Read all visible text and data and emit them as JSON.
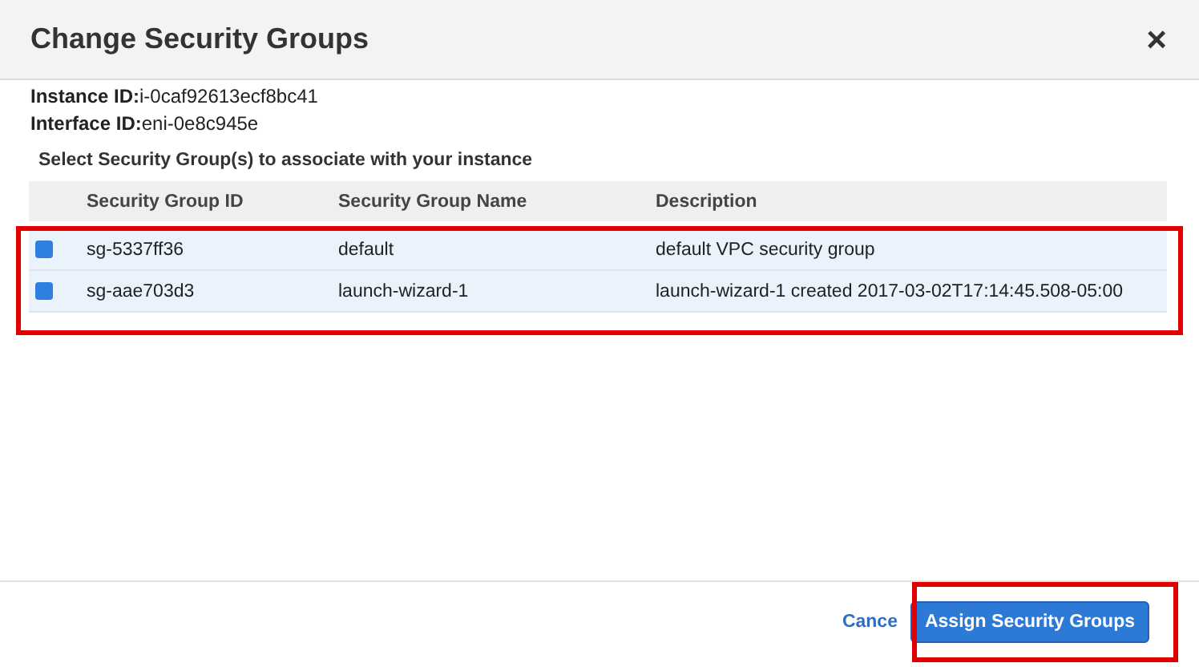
{
  "dialog": {
    "title": "Change Security Groups",
    "close": "×"
  },
  "info": [
    {
      "label": "Instance ID:",
      "value": "i-0caf92613ecf8bc41"
    },
    {
      "label": "Interface ID:",
      "value": "eni-0e8c945e"
    }
  ],
  "prompt": "Select Security Group(s) to associate with your instance",
  "table": {
    "columns": [
      "Security Group ID",
      "Security Group Name",
      "Description"
    ],
    "rows": [
      {
        "checked": true,
        "selected": true,
        "cells": [
          "sg-5337ff36",
          "default",
          "default VPC security group"
        ]
      },
      {
        "checked": true,
        "selected": true,
        "cells": [
          "sg-aae703d3",
          "launch-wizard-1",
          "launch-wizard-1 created 2017-03-02T17:14:45.508-05:00"
        ]
      }
    ]
  },
  "buttons": [
    {
      "kind": "link",
      "label": "Cance"
    },
    {
      "kind": "primary",
      "label": "Assign Security Groups"
    }
  ]
}
